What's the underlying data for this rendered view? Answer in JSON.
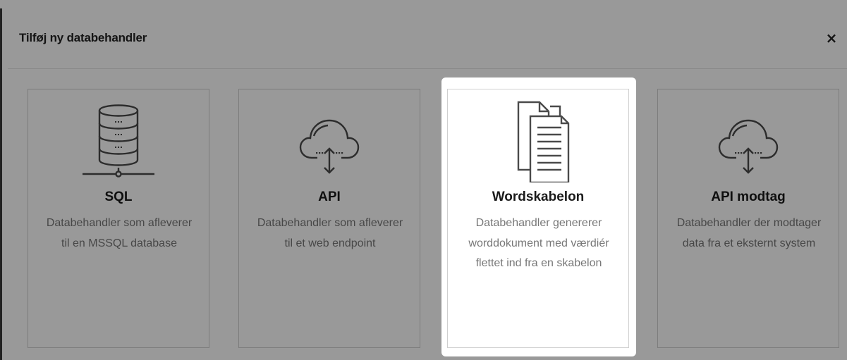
{
  "modal": {
    "title": "Tilføj ny databehandler",
    "close_label": "×"
  },
  "cards": [
    {
      "icon": "database-server-icon",
      "title": "SQL",
      "description": "Databehandler som afleverer til en MSSQL database"
    },
    {
      "icon": "cloud-upload-icon",
      "title": "API",
      "description": "Databehandler som afleverer til et web endpoint"
    },
    {
      "icon": "documents-icon",
      "title": "Wordskabelon",
      "description": "Databehandler genererer worddokument med værdiér flettet ind fra en skabelon"
    },
    {
      "icon": "cloud-download-icon",
      "title": "API modtag",
      "description": "Databehandler der modtager data fra et eksternt system"
    }
  ],
  "theme": {
    "overlay_color": "#000000",
    "card_border": "#cfcfcf",
    "description_color": "#777777",
    "title_color": "#1a1a1a",
    "icon_stroke": "#4a4a4a"
  }
}
